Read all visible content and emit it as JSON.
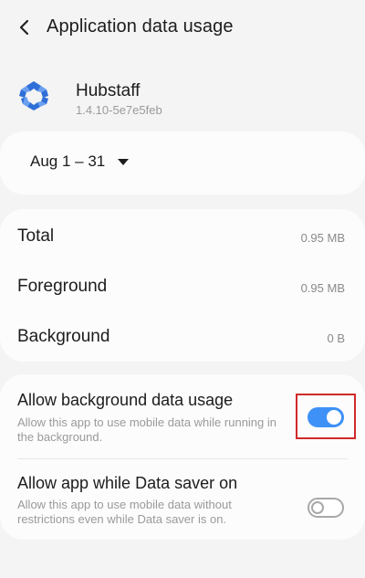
{
  "header": {
    "title": "Application data usage",
    "back_icon": "chevron-left-icon"
  },
  "app": {
    "name": "Hubstaff",
    "version": "1.4.10-5e7e5feb",
    "logo_icon": "hubstaff-logo-icon"
  },
  "period": {
    "label": "Aug 1 – 31"
  },
  "usage": [
    {
      "label": "Total",
      "value": "0.95 MB"
    },
    {
      "label": "Foreground",
      "value": "0.95 MB"
    },
    {
      "label": "Background",
      "value": "0 B"
    }
  ],
  "settings": {
    "background_data": {
      "title": "Allow background data usage",
      "description": "Allow this app to use mobile data while running in the background.",
      "enabled": true
    },
    "data_saver": {
      "title": "Allow app while Data saver on",
      "description": "Allow this app to use mobile data without restrictions even while Data saver is on.",
      "enabled": false
    }
  },
  "colors": {
    "accent": "#3e91f7",
    "highlight": "#d02a2a",
    "background": "#f4f4f4"
  }
}
